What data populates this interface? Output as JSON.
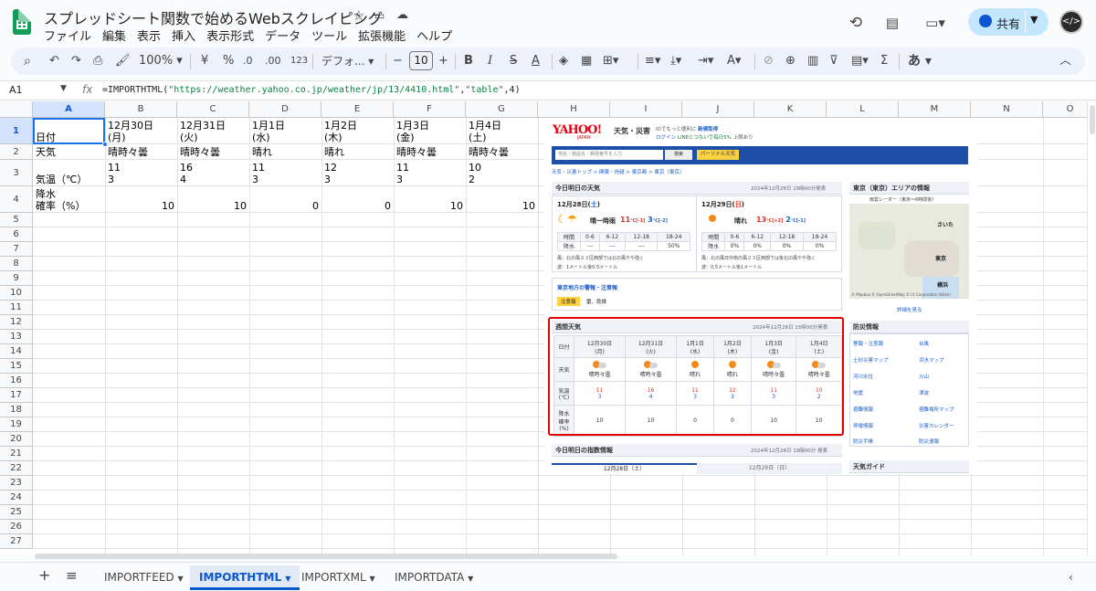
{
  "app": {
    "doc_title": "スプレッドシート関数で始めるWebスクレイピング",
    "menu": [
      "ファイル",
      "編集",
      "表示",
      "挿入",
      "表示形式",
      "データ",
      "ツール",
      "拡張機能",
      "ヘルプ"
    ],
    "share_label": "共有"
  },
  "toolbar": {
    "zoom": "100%",
    "currency": "¥",
    "percent": "%",
    "dec_decrease": ".0",
    "dec_increase": ".00",
    "number_format": "123",
    "font": "デフォ...",
    "font_size": "10",
    "bold": "B",
    "italic": "I",
    "strike": "S",
    "text_color": "A",
    "input_mode": "あ"
  },
  "formula_bar": {
    "cell_ref": "A1",
    "fx": "fx",
    "formula_prefix": "=IMPORTHTML(",
    "formula_url": "\"https://weather.yahoo.co.jp/weather/jp/13/4410.html\"",
    "formula_sep": ",",
    "formula_table": "\"table\"",
    "formula_suffix": ",4)"
  },
  "columns": [
    "A",
    "B",
    "C",
    "D",
    "E",
    "F",
    "G",
    "H",
    "I",
    "J",
    "K",
    "L",
    "M",
    "N",
    "O"
  ],
  "rows": [
    "1",
    "2",
    "3",
    "4",
    "5",
    "6",
    "7",
    "8",
    "9",
    "10",
    "11",
    "12",
    "13",
    "14",
    "15",
    "16",
    "17",
    "18",
    "19",
    "20",
    "21",
    "22",
    "23",
    "24",
    "25",
    "26",
    "27"
  ],
  "cells": {
    "r1": [
      "日付",
      "12月30日\n(月)",
      "12月31日\n(火)",
      "1月1日\n(水)",
      "1月2日\n(木)",
      "1月3日\n(金)",
      "1月4日\n(土)"
    ],
    "r2": [
      "天気",
      "晴時々曇",
      "晴時々曇",
      "晴れ",
      "晴れ",
      "晴時々曇",
      "晴時々曇"
    ],
    "r3": [
      "気温（℃）",
      "11\n3",
      "16\n4",
      "11\n3",
      "12\n3",
      "11\n3",
      "10\n2"
    ],
    "r4": [
      "降水\n確率（%）",
      "10",
      "10",
      "0",
      "0",
      "10",
      "10"
    ]
  },
  "sheet_tabs": [
    "IMPORTFEED",
    "IMPORTHTML",
    "IMPORTXML",
    "IMPORTDATA"
  ],
  "active_tab": "IMPORTHTML",
  "embed": {
    "logo": "YAHOO!",
    "logo_sub": "JAPAN",
    "section": "天気・災害",
    "promo1": "IDでもっと便利に",
    "promo1_link": "新規取得",
    "promo2": "ログイン",
    "promo3": "LINEとつないで毎日5%",
    "promo4": "上限あり",
    "search_placeholder": "地名・施設名・郵便番号を入力",
    "search_btn": "検索",
    "personal_btn": "パーソナル天気",
    "breadcrumb": "天気・災害トップ > 関東・信越 > 東京都 > 東京（東京）",
    "today_title": "今日明日の天気",
    "today_time": "2024年12月28日 19時00分発表",
    "day1": {
      "date": "12月28日",
      "dow": "土",
      "weather": "晴一時雨",
      "high": "11",
      "high_diff": "[-1]",
      "low": "3",
      "low_diff": "[-2]",
      "hours": [
        "時間",
        "0-6",
        "6-12",
        "12-18",
        "18-24"
      ],
      "rain": [
        "降水",
        "---",
        "---",
        "---",
        "50%"
      ],
      "wind": "風：北の風２３区西部では北の風やや強く",
      "wave": "波：1メートル後0.5メートル"
    },
    "day2": {
      "date": "12月29日",
      "dow": "日",
      "weather": "晴れ",
      "high": "13",
      "high_diff": "[+2]",
      "low": "2",
      "low_diff": "[-1]",
      "hours": [
        "時間",
        "0-6",
        "6-12",
        "12-18",
        "18-24"
      ],
      "rain": [
        "降水",
        "0%",
        "0%",
        "0%",
        "0%"
      ],
      "wind": "風：北の風日中南の風２３区西部では後北の風やや強く",
      "wave": "波：0.5メートル後1メートル"
    },
    "warn_title": "東京地方の警報・注意報",
    "warn_badge": "注意報",
    "warn_text": "雷、乾燥",
    "weekly_title": "週間天気",
    "weekly_time": "2024年12月28日 15時00分発表",
    "weekly_rowlabels": [
      "日付",
      "天気",
      "気温\n(℃)",
      "降水\n確率\n(%)"
    ],
    "weekly_dates": [
      "12月30日\n(月)",
      "12月31日\n(火)",
      "1月1日\n(水)",
      "1月2日\n(木)",
      "1月3日\n(金)",
      "1月4日\n(土)"
    ],
    "weekly_weather": [
      "晴時々曇",
      "晴時々曇",
      "晴れ",
      "晴れ",
      "晴時々曇",
      "晴時々曇"
    ],
    "weekly_high": [
      "11",
      "16",
      "11",
      "12",
      "11",
      "10"
    ],
    "weekly_low": [
      "3",
      "4",
      "3",
      "3",
      "3",
      "2"
    ],
    "weekly_rain": [
      "10",
      "10",
      "0",
      "0",
      "10",
      "10"
    ],
    "index_title": "今日明日の指数情報",
    "index_time": "2024年12月28日 19時00分 発表",
    "index_tab1": "12月28日（土）",
    "index_tab2": "12月29日（日）",
    "area_title": "東京（東京）エリアの情報",
    "radar_label": "雨雲レーダー（東京～6時間後）",
    "map_credit": "© Mapbox © OpenStreetMap © LY Corporation Yahoo!",
    "map_more": "詳細を見る",
    "bousai_title": "防災情報",
    "bousai_links": [
      "警報・注意報",
      "台風",
      "土砂災害マップ",
      "洪水マップ",
      "河川水位",
      "火山",
      "地震",
      "津波",
      "避難情報",
      "避難場所マップ",
      "停電情報",
      "災害カレンダー",
      "防災手帳",
      "防災速報"
    ],
    "guide_title": "天気ガイド",
    "map_labels": [
      "さいた",
      "東京",
      "横浜"
    ]
  }
}
